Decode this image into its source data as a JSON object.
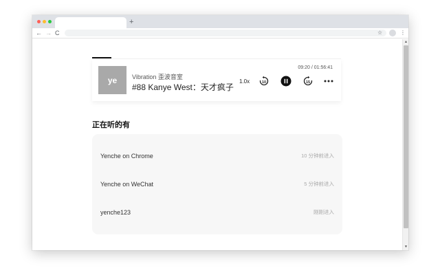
{
  "browser": {
    "new_tab": "+",
    "back": "←",
    "forward": "→",
    "reload": "C",
    "bookmark": "☆",
    "menu": "⋮"
  },
  "player": {
    "cover_text": "ye",
    "podcast": "Vibration 歪波音室",
    "episode": "#88 Kanye West：天才疯子",
    "time": "09:20 / 01:56:41",
    "speed": "1.0x",
    "icons": [
      "rewind-10-icon",
      "pause-icon",
      "forward-15-icon",
      "more-icon"
    ],
    "progress": 0.08
  },
  "listeners": {
    "title": "正在听的有",
    "items": [
      {
        "name": "Yenche on Chrome",
        "when": "10 分钟前进入"
      },
      {
        "name": "Yenche on WeChat",
        "when": "5 分钟前进入"
      },
      {
        "name": "yenche123",
        "when": "刚刚进入"
      }
    ]
  },
  "colors": {
    "accent": "#111111",
    "cover_bg": "#a9a9a9",
    "panel_bg": "#f7f7f7"
  }
}
